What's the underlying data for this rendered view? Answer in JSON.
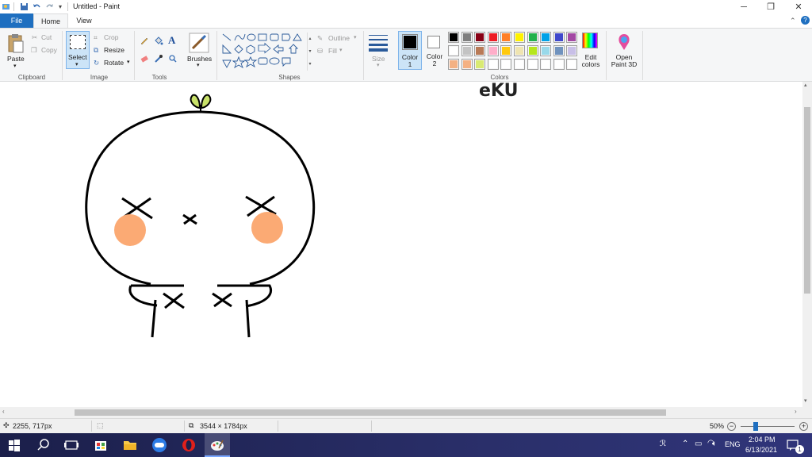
{
  "window": {
    "title": "Untitled - Paint",
    "minimize_glyph": "─",
    "restore_glyph": "❐",
    "close_glyph": "✕"
  },
  "tabs": [
    {
      "label": "File"
    },
    {
      "label": "Home"
    },
    {
      "label": "View"
    }
  ],
  "ribbon": {
    "clipboard": {
      "paste": "Paste",
      "cut": "Cut",
      "copy": "Copy",
      "group": "Clipboard"
    },
    "image": {
      "select": "Select",
      "crop": "Crop",
      "resize": "Resize",
      "rotate": "Rotate",
      "group": "Image"
    },
    "tools": {
      "group": "Tools"
    },
    "brushes": {
      "label": "Brushes"
    },
    "shapes": {
      "outline": "Outline",
      "fill": "Fill",
      "group": "Shapes"
    },
    "size": {
      "label": "Size"
    },
    "colors": {
      "color1": "Color 1",
      "color2": "Color 2",
      "edit_colors": "Edit colors",
      "group": "Colors",
      "color1_value": "#000000",
      "color2_value": "#ffffff",
      "palette_row1": [
        "#000000",
        "#7f7f7f",
        "#880015",
        "#ed1c24",
        "#ff7f27",
        "#fff200",
        "#22b14c",
        "#00a2e8",
        "#3f48cc",
        "#a349a4"
      ],
      "palette_row2": [
        "#ffffff",
        "#c3c3c3",
        "#b97a57",
        "#ffaec9",
        "#ffc90e",
        "#efe4b0",
        "#b5e61d",
        "#99d9ea",
        "#7092be",
        "#c8bfe7"
      ],
      "palette_row3": [
        "#f4b183",
        "#f4b183",
        "#d9ea72",
        "#ffffff",
        "#ffffff",
        "#ffffff",
        "#ffffff",
        "#ffffff",
        "#ffffff",
        "#ffffff"
      ]
    },
    "paint3d": {
      "label": "Open Paint 3D"
    }
  },
  "canvas": {
    "drawing_text": "eKU"
  },
  "status": {
    "cursor_pos": "2255, 717px",
    "canvas_size": "3544 × 1784px",
    "zoom": "50%"
  },
  "taskbar": {
    "language": "ENG",
    "time": "2:04 PM",
    "date": "6/13/2021",
    "notification_count": "1"
  }
}
